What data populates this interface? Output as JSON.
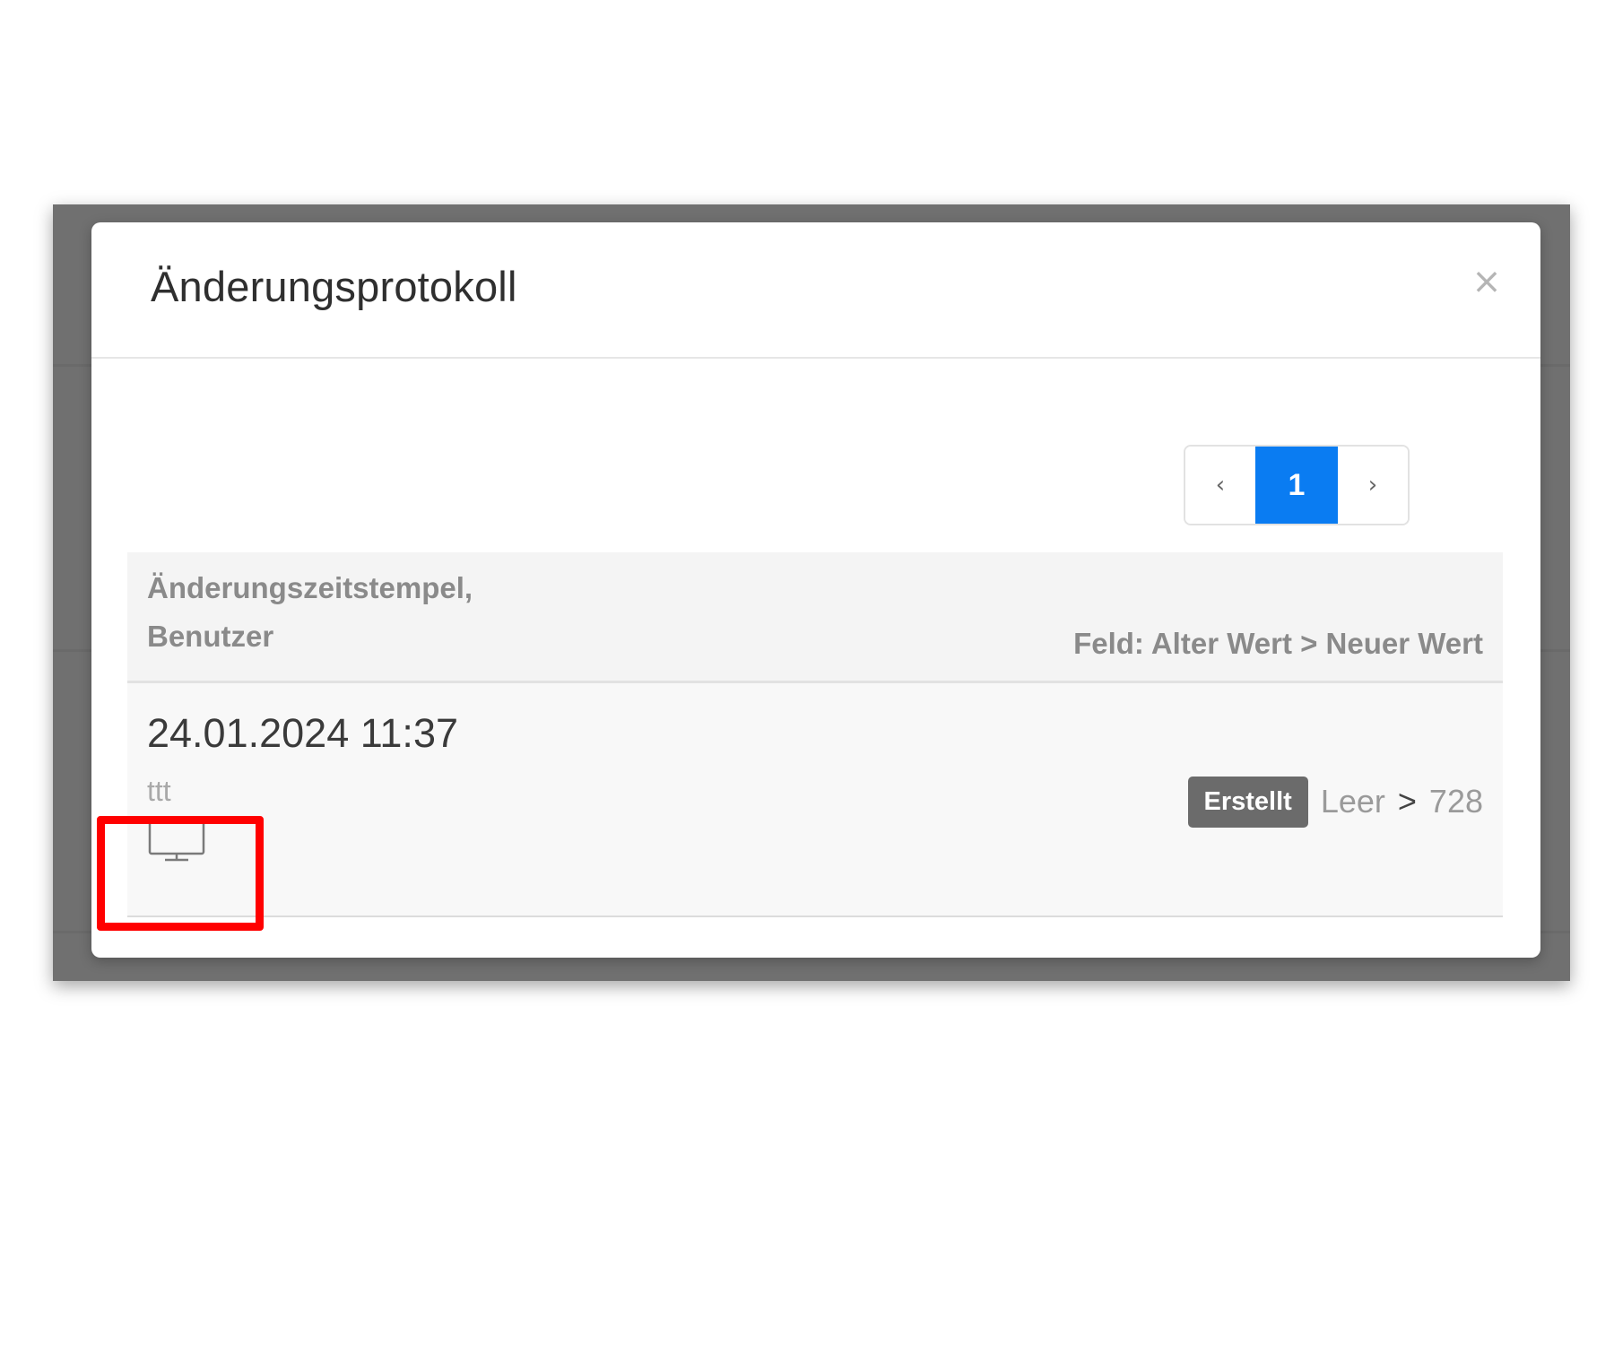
{
  "modal": {
    "title": "Änderungsprotokoll",
    "close_label": "×"
  },
  "pagination": {
    "prev_label": "‹",
    "current_page": "1",
    "next_label": "›"
  },
  "table": {
    "header_left_line1": "Änderungszeitstempel,",
    "header_left_line2": "Benutzer",
    "header_right": "Feld: Alter Wert > Neuer Wert",
    "rows": [
      {
        "timestamp": "24.01.2024 11:37",
        "user": "ttt",
        "device_icon": "monitor-icon",
        "badge": "Erstellt",
        "old_value": "Leer",
        "arrow": ">",
        "new_value": "728"
      }
    ]
  },
  "colors": {
    "accent": "#0a7cf2",
    "badge": "#6b6b6b",
    "highlight": "#ff0000"
  }
}
